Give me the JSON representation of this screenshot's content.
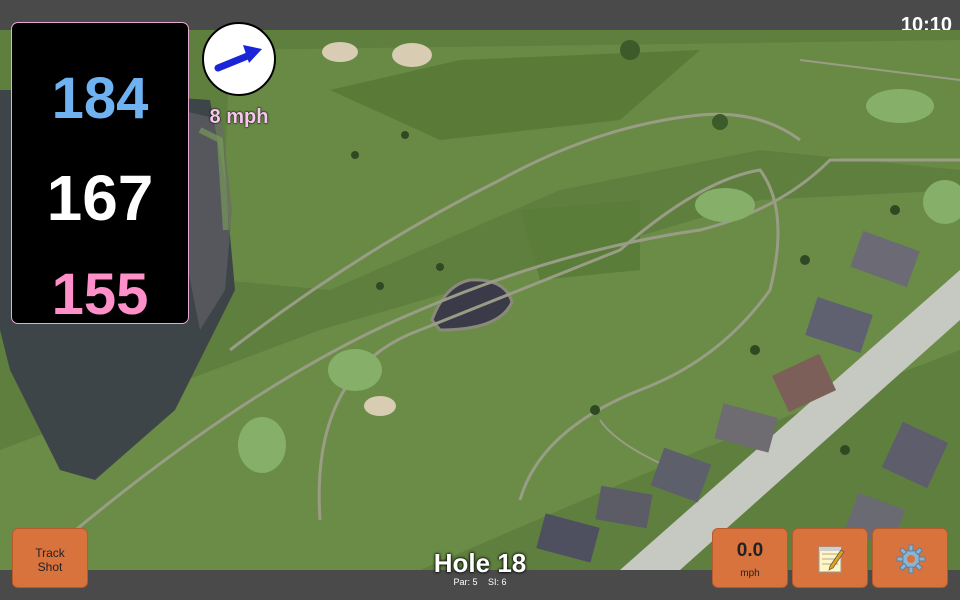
{
  "status_bar": {
    "time": "10:10"
  },
  "distances": {
    "back": "184",
    "middle": "167",
    "front": "155"
  },
  "wind": {
    "speed": "8 mph",
    "icon": "wind-direction-arrow-icon"
  },
  "buttons": {
    "track_shot_line1": "Track",
    "track_shot_line2": "Shot",
    "speed_value": "0.0",
    "speed_unit": "mph",
    "notes_icon": "notepad-icon",
    "settings_icon": "gear-icon"
  },
  "hole": {
    "title": "Hole 18",
    "par": "Par: 5",
    "si": "SI: 6"
  },
  "colors": {
    "back_distance": "#6fb2f2",
    "middle_distance": "#ffffff",
    "front_distance": "#ff8fc8",
    "button_orange": "#d9733e",
    "wind_arrow": "#1a25d8"
  }
}
